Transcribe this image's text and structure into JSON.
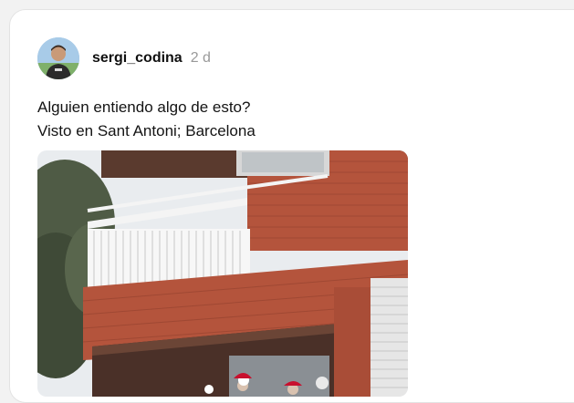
{
  "post": {
    "username": "sergi_codina",
    "time_ago": "2 d",
    "text_lines": [
      "Alguien entiendo algo de esto?",
      "Visto en Sant Antoni; Barcelona"
    ]
  },
  "colors": {
    "brick": "#b4543c",
    "text": "#141414",
    "muted": "#999999"
  },
  "icons": {
    "avatar": "user-avatar"
  }
}
